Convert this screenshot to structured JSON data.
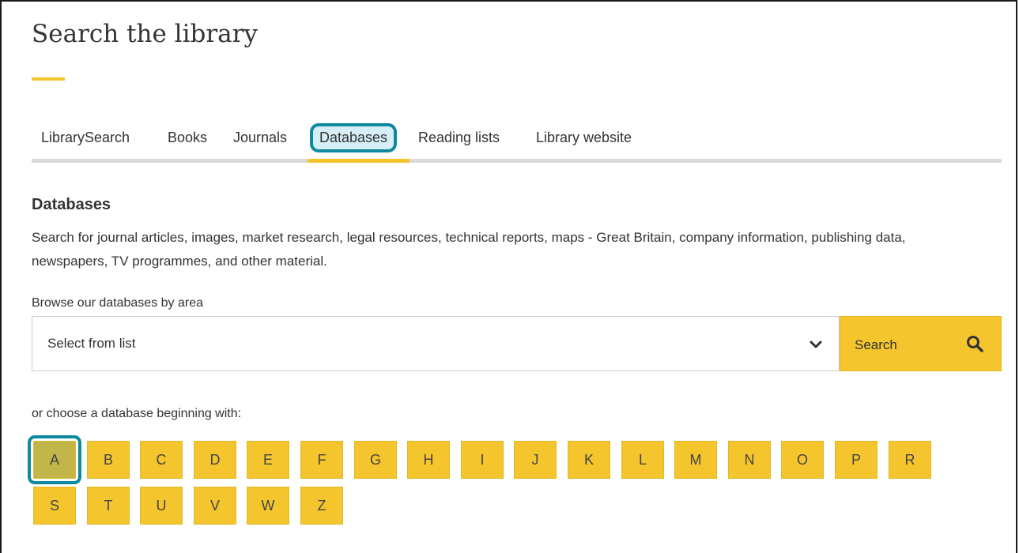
{
  "page": {
    "title": "Search the library"
  },
  "tabs": [
    {
      "label": "LibrarySearch",
      "active": false
    },
    {
      "label": "Books",
      "active": false
    },
    {
      "label": "Journals",
      "active": false
    },
    {
      "label": "Databases",
      "active": true
    },
    {
      "label": "Reading lists",
      "active": false
    },
    {
      "label": "Library website",
      "active": false
    }
  ],
  "databases": {
    "heading": "Databases",
    "description": "Search for journal articles, images, market research, legal resources, technical reports, maps - Great Britain, company information, publishing data, newspapers, TV programmes, and other material.",
    "browse_label": "Browse our databases by area",
    "select_value": "Select from list",
    "search_label": "Search",
    "letters_label": "or choose a database beginning with:",
    "letters": [
      "A",
      "B",
      "C",
      "D",
      "E",
      "F",
      "G",
      "H",
      "I",
      "J",
      "K",
      "L",
      "M",
      "N",
      "O",
      "P",
      "R",
      "S",
      "T",
      "U",
      "V",
      "W",
      "Z"
    ],
    "selected_letter": "A"
  },
  "icons": {
    "chevron": "chevron-down-icon",
    "search": "search-icon"
  },
  "colors": {
    "accent_yellow": "#f5c52d",
    "highlight_teal": "#0e8aa0",
    "selected_letter_bg": "#c2b64b",
    "tab_divider": "#d9d9d9"
  }
}
